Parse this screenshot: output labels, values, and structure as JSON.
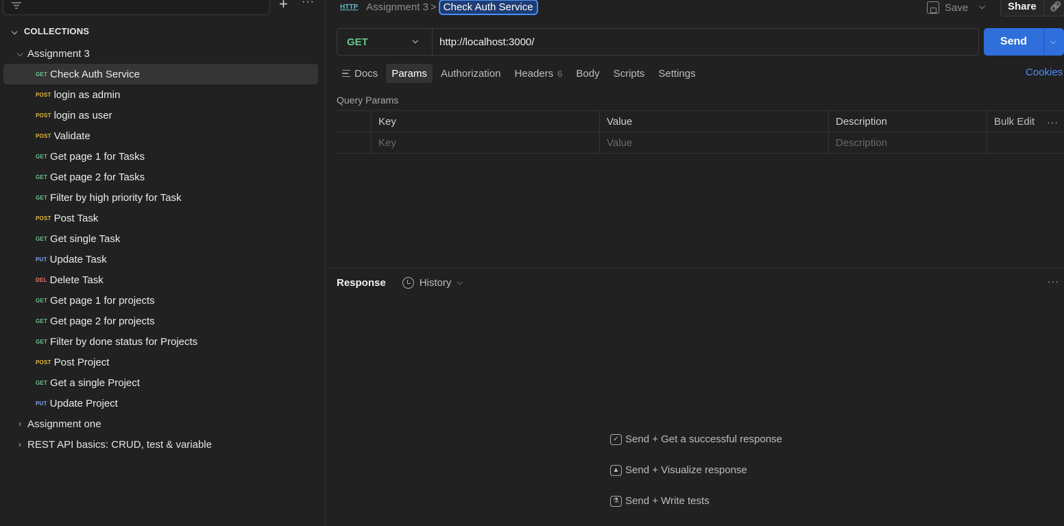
{
  "sidebar": {
    "section_title": "COLLECTIONS",
    "collections": [
      {
        "name": "Assignment 3",
        "expanded": true,
        "requests": [
          {
            "method": "GET",
            "name": "Check Auth Service",
            "selected": true
          },
          {
            "method": "POST",
            "name": "login as admin"
          },
          {
            "method": "POST",
            "name": "login as user"
          },
          {
            "method": "POST",
            "name": "Validate"
          },
          {
            "method": "GET",
            "name": "Get page 1 for Tasks"
          },
          {
            "method": "GET",
            "name": "Get page 2 for Tasks"
          },
          {
            "method": "GET",
            "name": "Filter by high priority for Task"
          },
          {
            "method": "POST",
            "name": "Post Task"
          },
          {
            "method": "GET",
            "name": "Get single Task"
          },
          {
            "method": "PUT",
            "name": "Update Task"
          },
          {
            "method": "DEL",
            "name": "Delete Task"
          },
          {
            "method": "GET",
            "name": "Get page 1 for projects"
          },
          {
            "method": "GET",
            "name": "Get page 2 for projects"
          },
          {
            "method": "GET",
            "name": "Filter by done status for Projects"
          },
          {
            "method": "POST",
            "name": "Post Project"
          },
          {
            "method": "GET",
            "name": "Get a single Project"
          },
          {
            "method": "PUT",
            "name": "Update Project"
          }
        ]
      },
      {
        "name": "Assignment one",
        "expanded": false
      },
      {
        "name": "REST API basics: CRUD, test & variable",
        "expanded": false
      }
    ]
  },
  "header": {
    "http_label": "HTTP",
    "breadcrumb_parent": "Assignment 3",
    "breadcrumb_separator": ">",
    "breadcrumb_current": "Check Auth Service",
    "save_label": "Save",
    "share_label": "Share"
  },
  "request": {
    "method": "GET",
    "url": "http://localhost:3000/",
    "send_label": "Send"
  },
  "tabs": [
    {
      "label": "Docs",
      "active": false
    },
    {
      "label": "Params",
      "active": true
    },
    {
      "label": "Authorization",
      "active": false
    },
    {
      "label": "Headers",
      "count": "6",
      "active": false
    },
    {
      "label": "Body",
      "active": false
    },
    {
      "label": "Scripts",
      "active": false
    },
    {
      "label": "Settings",
      "active": false
    }
  ],
  "cookies_label": "Cookies",
  "query_params": {
    "title": "Query Params",
    "columns": [
      "Key",
      "Value",
      "Description"
    ],
    "bulk_edit": "Bulk Edit",
    "placeholders": {
      "key": "Key",
      "value": "Value",
      "description": "Description"
    }
  },
  "response": {
    "title": "Response",
    "history_label": "History",
    "hints": [
      "Send + Get a successful response",
      "Send + Visualize response",
      "Send + Write tests"
    ]
  },
  "colors": {
    "get": "#6bc48f",
    "post": "#e2b93b",
    "put": "#7aa7e8",
    "del": "#ef7a6e",
    "accent": "#2f6fdc"
  }
}
